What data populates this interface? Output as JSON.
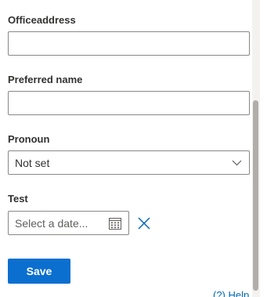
{
  "form": {
    "office_address": {
      "label": "Officeaddress",
      "value": ""
    },
    "preferred_name": {
      "label": "Preferred name",
      "value": ""
    },
    "pronoun": {
      "label": "Pronoun",
      "selected": "Not set",
      "icon": "chevron-down-icon"
    },
    "test": {
      "label": "Test",
      "placeholder": "Select a date...",
      "calendar_icon": "calendar-icon",
      "clear_icon": "close-icon"
    },
    "save_label": "Save"
  },
  "footer": {
    "help_link": "(?) Help"
  },
  "colors": {
    "accent": "#0b6fd0",
    "border": "#8a8886",
    "label": "#323130",
    "link": "#0067b8",
    "clear_icon": "#0067b8",
    "scroll_thumb": "#b0adab"
  }
}
